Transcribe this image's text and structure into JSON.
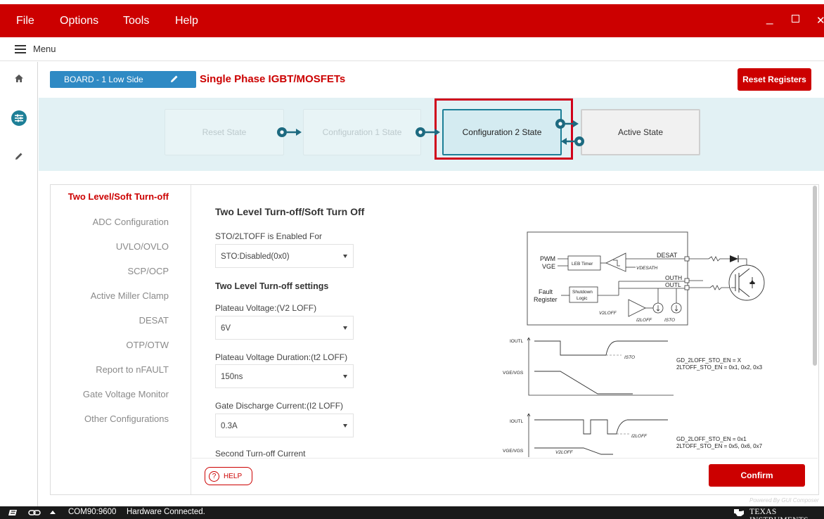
{
  "menubar": {
    "items": [
      "File",
      "Options",
      "Tools",
      "Help"
    ]
  },
  "secondary_menu": {
    "label": "Menu"
  },
  "board": {
    "badge": "BOARD - 1 Low Side",
    "title": "Single Phase IGBT/MOSFETs",
    "reset_button": "Reset Registers"
  },
  "states": {
    "reset": "Reset State",
    "config1": "Configuration 1 State",
    "config2": "Configuration 2 State",
    "active": "Active State"
  },
  "sidebar": {
    "items": [
      "Two Level/Soft Turn-off",
      "ADC Configuration",
      "UVLO/OVLO",
      "SCP/OCP",
      "Active Miller Clamp",
      "DESAT",
      "OTP/OTW",
      "Report to nFAULT",
      "Gate Voltage Monitor",
      "Other Configurations"
    ],
    "active_index": 0
  },
  "content": {
    "title": "Two Level Turn-off/Soft Turn Off",
    "sto_label": "STO/2LTOFF is Enabled For",
    "sto_value": "STO:Disabled(0x0)",
    "settings_heading": "Two Level Turn-off settings",
    "plateau_label": "Plateau Voltage:(V2 LOFF)",
    "plateau_value": "6V",
    "duration_label": "Plateau Voltage Duration:(t2 LOFF)",
    "duration_value": "150ns",
    "discharge_label": "Gate Discharge Current:(I2 LOFF)",
    "discharge_value": "0.3A",
    "second_label": "Second Turn-off Current"
  },
  "diagram": {
    "pwm": "PWM",
    "vge": "VGE",
    "leb": "LEB Timer",
    "desat": "DESAT",
    "vdesath": "VDESATH",
    "outh": "OUTH",
    "outl": "OUTL",
    "fault": "Fault",
    "register": "Register",
    "shutdown1": "Shutdown",
    "shutdown2": "Logic",
    "v2loff": "V2LOFF",
    "i2loff": "I2LOFF",
    "isto": "ISTO",
    "iout": "IOUTL",
    "vge_vgs": "VGE/VGS",
    "isto_wave": "ISTO",
    "i2loff_wave": "I2LOFF",
    "v2loff_wave": "V2LOFF",
    "note1a": "GD_2LOFF_STO_EN = X",
    "note1b": "2LTOFF_STO_EN = 0x1, 0x2, 0x3",
    "note2a": "GD_2LOFF_STO_EN = 0x1",
    "note2b": "2LTOFF_STO_EN = 0x5, 0x6, 0x7"
  },
  "footer": {
    "help": "HELP",
    "confirm": "Confirm",
    "powered": "Powered By GUI Composer"
  },
  "statusbar": {
    "port": "COM90:9600",
    "connection": "Hardware Connected.",
    "brand": "TEXAS INSTRUMENTS"
  },
  "colors": {
    "brand_red": "#cc0000",
    "accent_blue": "#2f8ac4",
    "teal": "#1d7f97",
    "state_bg": "#e2f1f4"
  },
  "icons": [
    "hamburger-icon",
    "home-icon",
    "sliders-icon",
    "pencil-icon",
    "help-icon",
    "link-icon",
    "ti-logo-icon"
  ]
}
